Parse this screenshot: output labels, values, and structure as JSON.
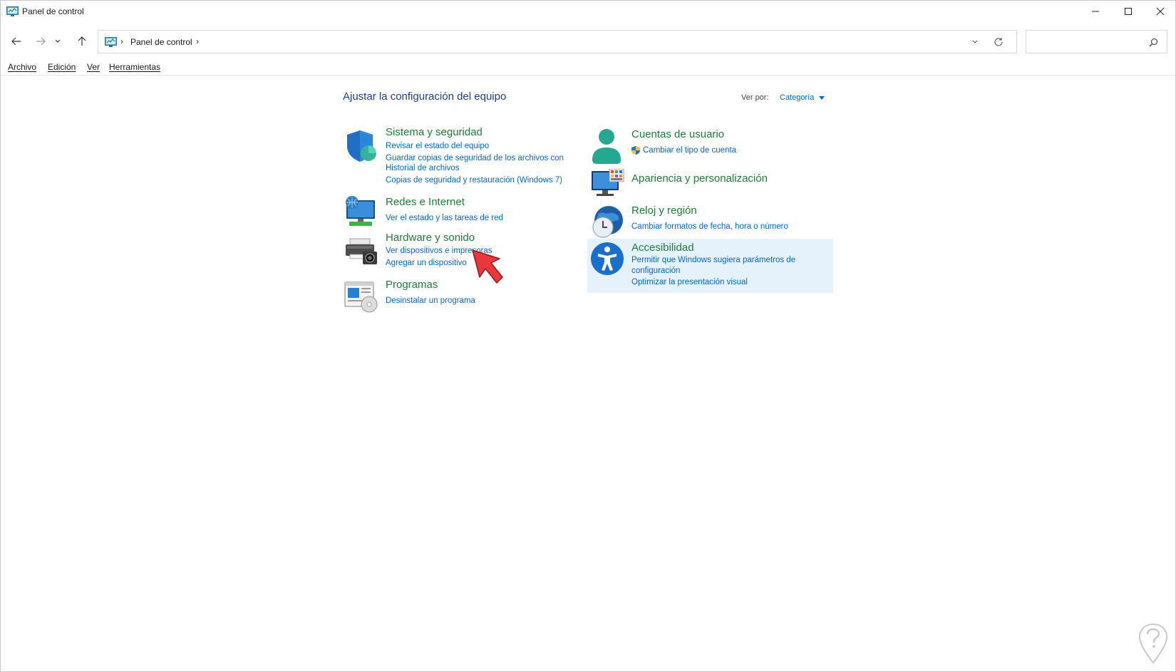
{
  "window": {
    "title": "Panel de control"
  },
  "addressbar": {
    "separator": "›",
    "crumb": "Panel de control"
  },
  "search": {
    "placeholder": ""
  },
  "menu": {
    "items": [
      "Archivo",
      "Edición",
      "Ver",
      "Herramientas"
    ]
  },
  "content": {
    "title": "Ajustar la configuración del equipo",
    "view_by_label": "Ver por:",
    "view_by_value": "Categoría"
  },
  "categories": {
    "system": {
      "title": "Sistema y seguridad",
      "links": [
        "Revisar el estado del equipo",
        "Guardar copias de seguridad de los archivos con",
        "Historial de archivos",
        "Copias de seguridad y restauración (Windows 7)"
      ]
    },
    "network": {
      "title": "Redes e Internet",
      "links": [
        "Ver el estado y las tareas de red"
      ]
    },
    "hardware": {
      "title": "Hardware y sonido",
      "links": [
        "Ver dispositivos e impresoras",
        "Agregar un dispositivo"
      ]
    },
    "programs": {
      "title": "Programas",
      "links": [
        "Desinstalar un programa"
      ]
    },
    "accounts": {
      "title": "Cuentas de usuario",
      "links": [
        "Cambiar el tipo de cuenta"
      ]
    },
    "appearance": {
      "title": "Apariencia y personalización"
    },
    "clock": {
      "title": "Reloj y región",
      "links": [
        "Cambiar formatos de fecha, hora o número"
      ]
    },
    "accessibility": {
      "title": "Accesibilidad",
      "links": [
        "Permitir que Windows sugiera parámetros de",
        "configuración",
        "Optimizar la presentación visual"
      ]
    }
  },
  "colors": {
    "category_title": "#1f7a35",
    "link": "#0066cc",
    "heading": "#1e3e8a",
    "highlight": "#e5f1fb",
    "pointer": "#e8383d"
  }
}
